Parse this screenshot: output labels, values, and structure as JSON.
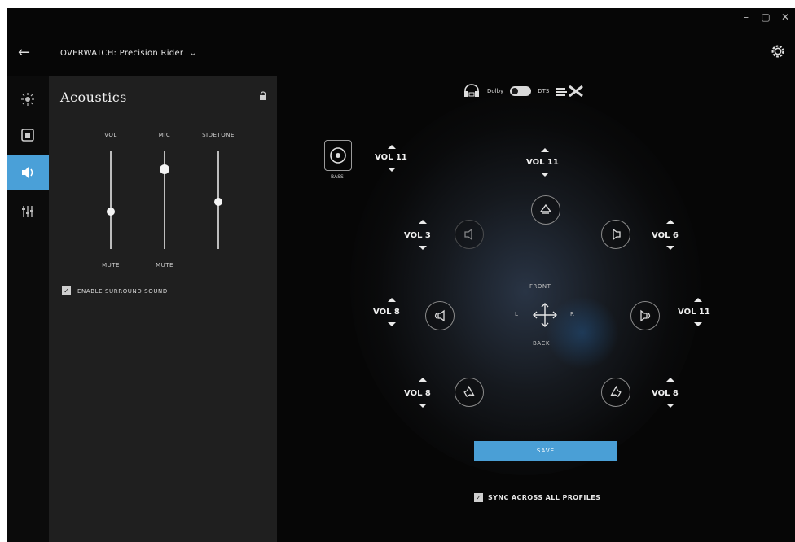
{
  "window": {
    "minimize": "–",
    "maximize": "▢",
    "close": "✕"
  },
  "header": {
    "profile_title": "OVERWATCH: Precision Rider",
    "dropdown_caret": "⌄"
  },
  "rail": [
    "lighting",
    "display",
    "audio",
    "equalizer"
  ],
  "panel": {
    "title": "Acoustics",
    "sliders": [
      {
        "label": "VOL",
        "level": 0.38,
        "bottom_label": "MUTE"
      },
      {
        "label": "MIC",
        "level": 0.82,
        "bottom_label": "MUTE"
      },
      {
        "label": "SIDETONE",
        "level": 0.48,
        "bottom_label": ""
      }
    ],
    "surround_label": "ENABLE SURROUND SOUND",
    "surround_checked": true
  },
  "stage": {
    "dolby_label": "Dolby",
    "dts_label": "DTS",
    "bass_label": "BASS",
    "bass_vol": "VOL 11",
    "center_vol": "VOL 11",
    "front_left_vol": "VOL 3",
    "front_right_vol": "VOL 6",
    "side_left_vol": "VOL 8",
    "side_right_vol": "VOL 11",
    "rear_left_vol": "VOL 8",
    "rear_right_vol": "VOL 8",
    "front_label": "FRONT",
    "back_label": "BACK",
    "left_label": "L",
    "right_label": "R",
    "save_label": "SAVE",
    "sync_label": "SYNC ACROSS ALL PROFILES",
    "sync_checked": true
  },
  "colors": {
    "accent": "#4a9fd6",
    "panel": "#1f1f1f",
    "background": "#060606"
  }
}
